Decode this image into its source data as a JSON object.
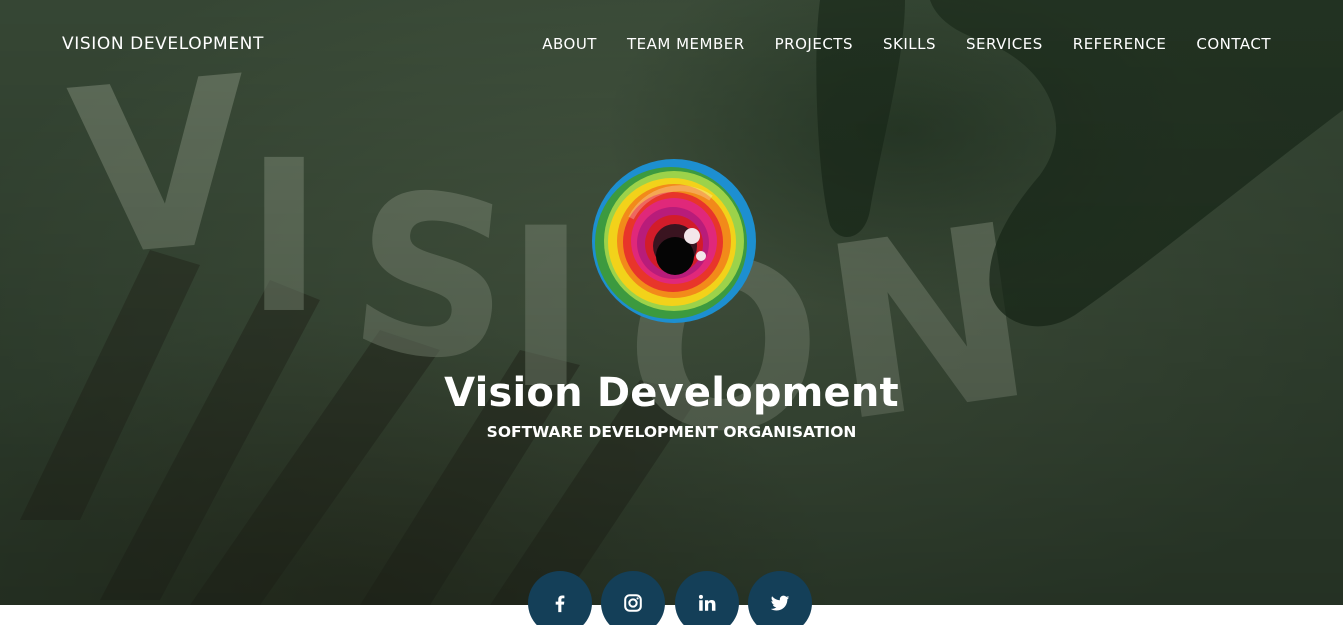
{
  "navbar": {
    "brand": "VISION DEVELOPMENT",
    "links": [
      "ABOUT",
      "TEAM MEMBER",
      "PROJECTS",
      "SKILLS",
      "SERVICES",
      "REFERENCE",
      "CONTACT"
    ]
  },
  "hero": {
    "title": "Vision Development",
    "subtitle": "SOFTWARE DEVELOPMENT ORGANISATION",
    "logo_icon": "rainbow-eye-logo",
    "background_words": "VISION"
  },
  "social": [
    {
      "icon": "facebook-icon"
    },
    {
      "icon": "instagram-icon"
    },
    {
      "icon": "linkedin-icon"
    },
    {
      "icon": "twitter-icon"
    }
  ],
  "colors": {
    "overlay": "#3c4a3a",
    "social_bg": "#143f58",
    "text": "#ffffff"
  }
}
